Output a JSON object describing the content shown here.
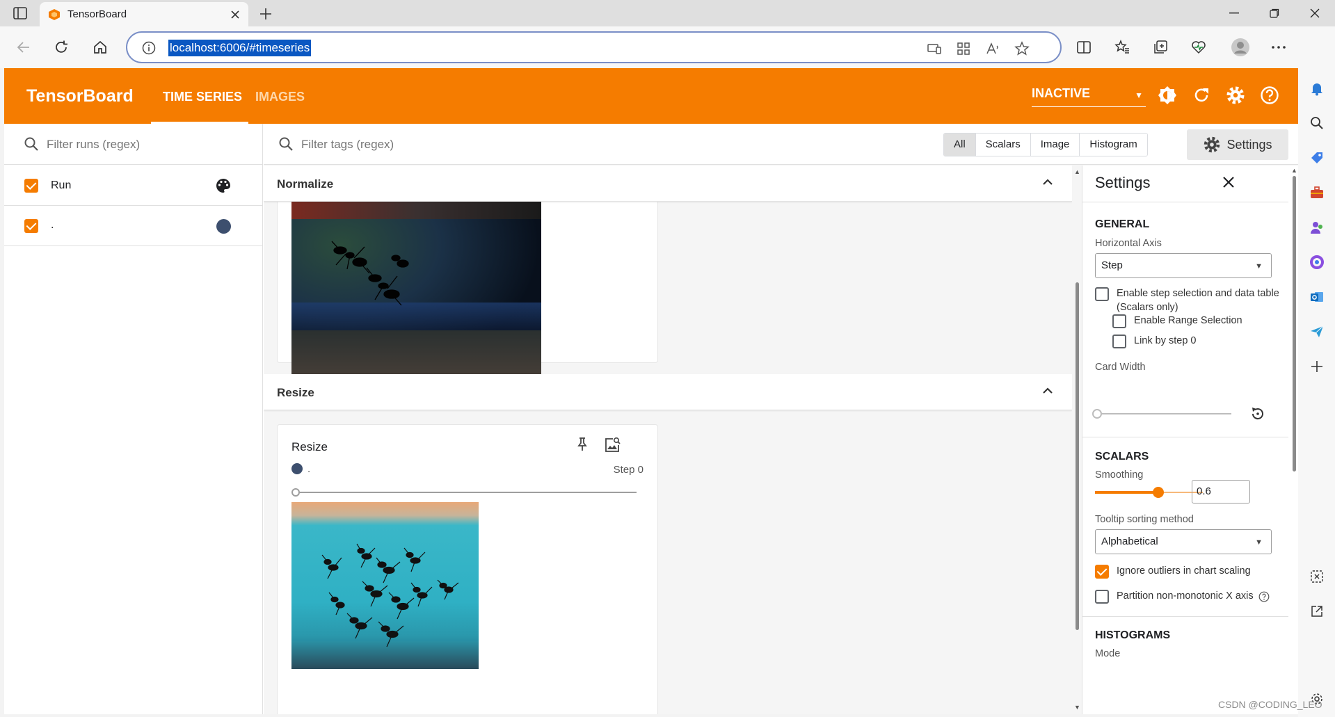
{
  "browser": {
    "tab_title": "TensorBoard",
    "url": "localhost:6006/#timeseries"
  },
  "app": {
    "brand": "TensorBoard",
    "tabs": [
      {
        "label": "TIME SERIES",
        "active": true
      },
      {
        "label": "IMAGES",
        "active": false
      }
    ],
    "reload_select": {
      "value": "INACTIVE"
    },
    "accent_color": "#f57c00"
  },
  "runs": {
    "filter_placeholder": "Filter runs (regex)",
    "header_label": "Run",
    "items": [
      {
        "label": ".",
        "checked": true,
        "color": "#3d4f6e"
      }
    ]
  },
  "tags": {
    "filter_placeholder": "Filter tags (regex)",
    "type_filters": [
      "All",
      "Scalars",
      "Image",
      "Histogram"
    ],
    "selected_type": "All",
    "settings_button": "Settings"
  },
  "groups": [
    {
      "title": "Normalize"
    },
    {
      "title": "Resize",
      "card": {
        "title": "Resize",
        "run_label": ".",
        "step_label": "Step 0",
        "step_value": 0
      }
    }
  ],
  "settings": {
    "title": "Settings",
    "general": {
      "heading": "GENERAL",
      "horizontal_axis_label": "Horizontal Axis",
      "horizontal_axis_value": "Step",
      "step_selection_label": "Enable step selection and data table",
      "step_selection_sub": "(Scalars only)",
      "range_selection_label": "Enable Range Selection",
      "link_step_label": "Link by step 0",
      "card_width_label": "Card Width"
    },
    "scalars": {
      "heading": "SCALARS",
      "smoothing_label": "Smoothing",
      "smoothing_value": "0.6",
      "smoothing_fraction": 0.6,
      "tooltip_sort_label": "Tooltip sorting method",
      "tooltip_sort_value": "Alphabetical",
      "ignore_outliers_label": "Ignore outliers in chart scaling",
      "ignore_outliers_checked": true,
      "partition_label": "Partition non-monotonic X axis"
    },
    "histograms": {
      "heading": "HISTOGRAMS",
      "mode_label": "Mode"
    }
  },
  "watermark": "CSDN @CODING_LEO"
}
